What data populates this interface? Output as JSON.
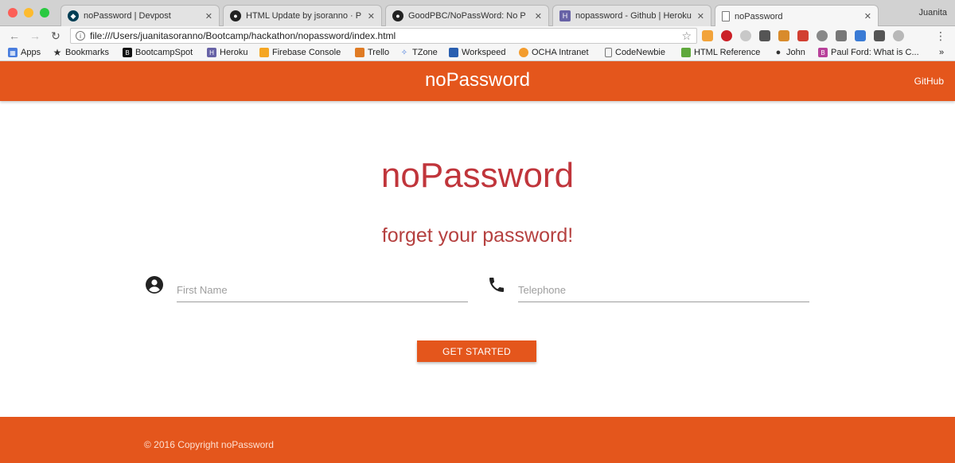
{
  "browser": {
    "tabs": [
      {
        "title": "noPassword | Devpost",
        "icon": "devpost-icon"
      },
      {
        "title": "HTML Update by jsoranno · P",
        "icon": "github-icon"
      },
      {
        "title": "GoodPBC/NoPassWord: No P",
        "icon": "github-icon"
      },
      {
        "title": "nopassword - Github | Heroku",
        "icon": "heroku-icon"
      },
      {
        "title": "noPassword",
        "icon": "page-icon",
        "active": true
      }
    ],
    "user": "Juanita",
    "url": "file:///Users/juanitasoranno/Bootcamp/hackathon/nopassword/index.html",
    "bookmarks": [
      {
        "label": "Apps",
        "icon": "apps-grid-icon"
      },
      {
        "label": "Bookmarks",
        "icon": "star-icon"
      },
      {
        "label": "BootcampSpot",
        "icon": "b-icon"
      },
      {
        "label": "Heroku",
        "icon": "heroku-icon"
      },
      {
        "label": "Firebase Console",
        "icon": "firebase-icon"
      },
      {
        "label": "Trello",
        "icon": "trello-icon"
      },
      {
        "label": "TZone",
        "icon": "tzone-icon"
      },
      {
        "label": "Workspeed",
        "icon": "workspeed-icon"
      },
      {
        "label": "OCHA Intranet",
        "icon": "ocha-icon"
      },
      {
        "label": "CodeNewbie",
        "icon": "page-icon"
      },
      {
        "label": "HTML Reference",
        "icon": "html-icon"
      },
      {
        "label": "John",
        "icon": "apple-icon"
      },
      {
        "label": "Paul Ford: What is C...",
        "icon": "b-icon"
      }
    ],
    "overflow": "»"
  },
  "navbar": {
    "brand": "noPassword",
    "link": "GitHub"
  },
  "hero": {
    "title": "noPassword",
    "subtitle": "forget your password!"
  },
  "form": {
    "first_name_placeholder": "First Name",
    "telephone_placeholder": "Telephone",
    "submit_label": "GET STARTED"
  },
  "footer": {
    "copyright": "© 2016 Copyright noPassword"
  },
  "colors": {
    "accent": "#e4561c",
    "title": "#c0353b"
  }
}
